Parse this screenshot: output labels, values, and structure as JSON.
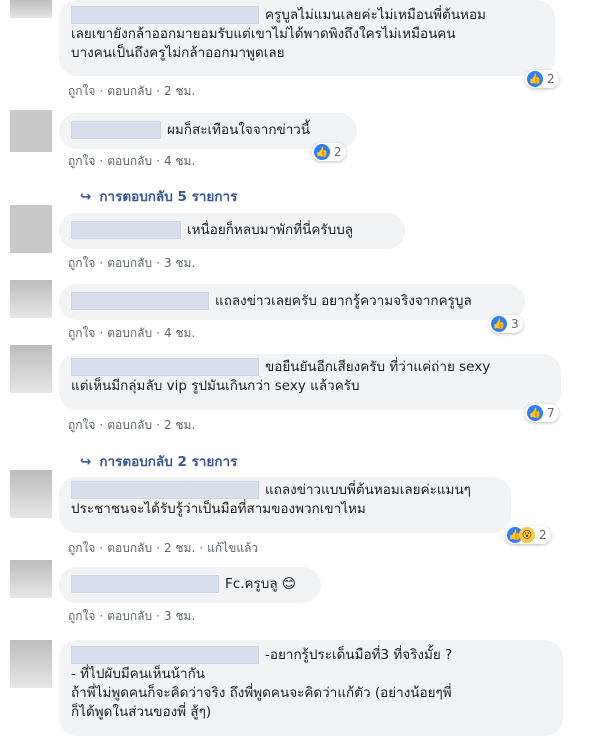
{
  "actions": {
    "like": "ถูกใจ",
    "reply": "ตอบกลับ",
    "edited": "แก้ไขแล้ว"
  },
  "comments": [
    {
      "text": "ครูบูลไม่แมนเลยค่ะไม่เหมือนพี่ต้นหอม\nเลยเขายังกล้าออกมายอมรับแต่เขาไม่ได้พาดพิงถึงใครไม่เหมือนคน\nบางคนเป็นถึงครูไม่กล้าออกมาพูดเลย",
      "time": "2 ชม.",
      "reaction_count": "2"
    },
    {
      "text": "ผมก็สะเทือนใจจากข่าวนี้",
      "time": "4 ชม.",
      "reaction_count": "2"
    },
    {
      "text": "เหนื่อยก็หลบมาพักที่นี่ครับบลู",
      "time": "3 ชม."
    },
    {
      "text": "แถลงข่าวเลยครับ อยากรู้ความจริงจากครูบูล",
      "time": "4 ชม.",
      "reaction_count": "3"
    },
    {
      "text": "ขอยืนยันอีกเสียงครับ ที่ว่าแค่ถ่าย sexy\nแต่เห็นมีกลุ่มลับ vip รูปมันเกินกว่า sexy แล้วครับ",
      "time": "2 ชม.",
      "reaction_count": "7"
    },
    {
      "text": "แถลงข่าวแบบพี่ต้นหอมเลยค่ะแมนๆ\nประชาชนจะได้รับรู้ว่าเป็นมือที่สามของพวกเขาไหม",
      "time": "2 ชม.",
      "reaction_count": "2"
    },
    {
      "text": "Fc.ครูบลู 😊",
      "time": "3 ชม."
    },
    {
      "text": "-อยากรู้ประเด็นมือที่3 ที่จริงมั้ย ?\n- ที่ไปผับมีคนเห็นน้ากัน\nถ้าพี่ไม่พูดคนก็จะคิดว่าจริง ถึงพี่พูดคนจะคิดว่าแก้ตัว (อย่างน้อยๆพี่\nก็ได้พูดในส่วนของพี่ สู้ๆ)"
    }
  ],
  "reply_links": [
    "การตอบกลับ 5 รายการ",
    "การตอบกลับ 2 รายการ"
  ],
  "icons": {
    "like": "thumbs-up-icon",
    "wow": "wow-face-icon",
    "reply_arrow": "reply-arrow-icon"
  },
  "colors": {
    "bubble": "#f2f3f5",
    "link": "#385898",
    "like": "#2d7ff9"
  }
}
